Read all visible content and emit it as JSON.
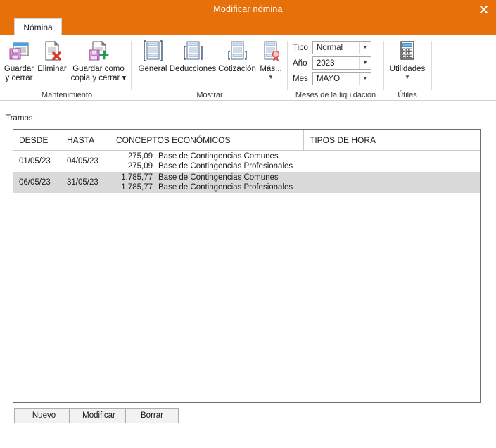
{
  "window": {
    "title": "Modificar nómina",
    "close_icon": "close-icon",
    "titlebar_color": "#e8700a"
  },
  "tabs": [
    {
      "label": "Nómina",
      "active": true
    }
  ],
  "ribbon": {
    "groups": [
      {
        "name": "mantenimiento",
        "label": "Mantenimiento",
        "buttons": [
          {
            "name": "guardar-y-cerrar",
            "icon": "save-window-icon",
            "line1": "Guardar",
            "line2": "y cerrar",
            "has_caret": false
          },
          {
            "name": "eliminar",
            "icon": "document-delete-icon",
            "line1": "Eliminar",
            "line2": "",
            "has_caret": false
          },
          {
            "name": "guardar-como-copia-y-cerrar",
            "icon": "save-copy-icon",
            "line1": "Guardar como",
            "line2": "copia y cerrar ▾",
            "has_caret": false
          }
        ]
      },
      {
        "name": "mostrar",
        "label": "Mostrar",
        "buttons": [
          {
            "name": "general",
            "icon": "document-brackets-icon",
            "line1": "General",
            "line2": "",
            "has_caret": false
          },
          {
            "name": "deducciones",
            "icon": "document-brackets-icon",
            "line1": "Deducciones",
            "line2": "",
            "has_caret": false
          },
          {
            "name": "cotizacion",
            "icon": "document-brackets-icon",
            "line1": "Cotización",
            "line2": "",
            "has_caret": false
          },
          {
            "name": "mas",
            "icon": "document-seal-icon",
            "line1": "Más...",
            "line2": "",
            "has_caret": true
          }
        ]
      },
      {
        "name": "meses-de-la-liquidacion",
        "label": "Meses de la liquidación",
        "fields": [
          {
            "name": "tipo",
            "label": "Tipo",
            "value": "Normal"
          },
          {
            "name": "ano",
            "label": "Año",
            "value": "2023"
          },
          {
            "name": "mes",
            "label": "Mes",
            "value": "MAYO"
          }
        ]
      },
      {
        "name": "utiles",
        "label": "Útiles",
        "buttons": [
          {
            "name": "utilidades",
            "icon": "calculator-icon",
            "line1": "Utilidades",
            "line2": "",
            "has_caret": true
          }
        ]
      }
    ]
  },
  "main": {
    "section_label": "Tramos",
    "table": {
      "columns": [
        {
          "key": "desde",
          "label": "DESDE"
        },
        {
          "key": "hasta",
          "label": "HASTA"
        },
        {
          "key": "conceptos",
          "label": "CONCEPTOS ECONÓMICOS"
        },
        {
          "key": "tipos_hora",
          "label": "TIPOS DE HORA"
        }
      ],
      "rows": [
        {
          "selected": false,
          "desde": "01/05/23",
          "hasta": "04/05/23",
          "conceptos": [
            {
              "amount": "275,09",
              "label": "Base de Contingencias Comunes"
            },
            {
              "amount": "275,09",
              "label": "Base de Contingencias Profesionales"
            }
          ],
          "tipos_hora": ""
        },
        {
          "selected": true,
          "desde": "06/05/23",
          "hasta": "31/05/23",
          "conceptos": [
            {
              "amount": "1.785,77",
              "label": "Base de Contingencias Comunes"
            },
            {
              "amount": "1.785,77",
              "label": "Base de Contingencias Profesionales"
            }
          ],
          "tipos_hora": ""
        }
      ]
    }
  },
  "footer": {
    "buttons": [
      {
        "name": "nuevo",
        "label": "Nuevo"
      },
      {
        "name": "modificar",
        "label": "Modificar"
      },
      {
        "name": "borrar",
        "label": "Borrar"
      }
    ]
  }
}
